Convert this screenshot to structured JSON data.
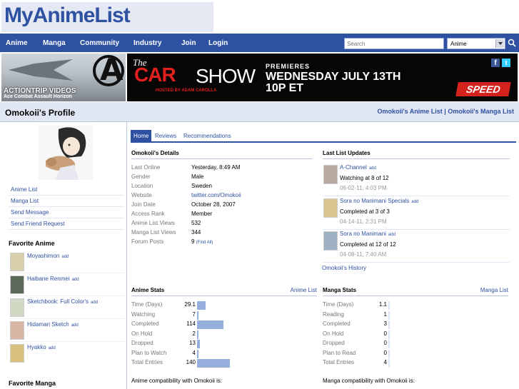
{
  "logo": {
    "text": "MyAnimeList"
  },
  "nav": {
    "items": [
      "Anime",
      "Manga",
      "Community",
      "Industry",
      "Join",
      "Login"
    ]
  },
  "search": {
    "placeholder": "Search",
    "type_selected": "Anime"
  },
  "ads": {
    "left_title": "ACTIONTRIP VIDEOS",
    "left_sub": "Ace Combat Assault Horizon",
    "right_the": "The",
    "right_car": "CAR",
    "right_show": "SHOW",
    "right_host": "HOSTED BY ADAM CAROLLA",
    "right_premieres": "PREMIERES",
    "right_date": "WEDNESDAY JULY 13TH",
    "right_time": "10P ET",
    "right_brand": "SPEED"
  },
  "header": {
    "title": "Omokoii's Profile",
    "anime_list_link": "Omokoii's Anime List",
    "separator": "|",
    "manga_list_link": "Omokoii's Manga List"
  },
  "sidebar": {
    "links": [
      "Anime List",
      "Manga List",
      "Send Message",
      "Send Friend Request"
    ],
    "favorite_anime_heading": "Favorite Anime",
    "favorite_anime": [
      {
        "name": "Moyashimon",
        "add": "add"
      },
      {
        "name": "Haibane Renmei",
        "add": "add"
      },
      {
        "name": "Sketchbook: Full Color's",
        "add": "add"
      },
      {
        "name": "Hidamari Sketch",
        "add": "add"
      },
      {
        "name": "Hyakko",
        "add": "add"
      }
    ],
    "favorite_manga_heading": "Favorite Manga"
  },
  "tabs": [
    "Home",
    "Reviews",
    "Recommendations"
  ],
  "details": {
    "heading": "Omokoii's Details",
    "rows": [
      {
        "k": "Last Online",
        "v": "Yesterday, 8:49 AM"
      },
      {
        "k": "Gender",
        "v": "Male"
      },
      {
        "k": "Location",
        "v": "Sweden"
      },
      {
        "k": "Website",
        "v": "twitter.com/Omokoii"
      },
      {
        "k": "Join Date",
        "v": "October 28, 2007"
      },
      {
        "k": "Access Rank",
        "v": "Member"
      },
      {
        "k": "Anime List Views",
        "v": "532"
      },
      {
        "k": "Manga List Views",
        "v": "344"
      },
      {
        "k": "Forum Posts",
        "v": "9",
        "extra": "(Find All)"
      }
    ]
  },
  "updates": {
    "heading": "Last List Updates",
    "items": [
      {
        "name": "A-Channel",
        "add": "add",
        "status": "Watching at 8 of 12",
        "date": "06-02-11, 4:03 PM"
      },
      {
        "name": "Sora no Manimani Specials",
        "add": "add",
        "status": "Completed at 3 of 3",
        "date": "04-14-11, 2:31 PM"
      },
      {
        "name": "Sora no Manimani",
        "add": "add",
        "status": "Completed at 12 of 12",
        "date": "04-08-11, 7:40 AM"
      }
    ],
    "history_link": "Omokoii's History"
  },
  "anime_stats": {
    "heading": "Anime Stats",
    "link": "Anime List",
    "rows": [
      {
        "k": "Time (Days)",
        "v": "29.1",
        "fraction": 0.25
      },
      {
        "k": "Watching",
        "v": "7",
        "fraction": 0.05
      },
      {
        "k": "Completed",
        "v": "114",
        "fraction": 0.81
      },
      {
        "k": "On Hold",
        "v": "2",
        "fraction": 0.015
      },
      {
        "k": "Dropped",
        "v": "13",
        "fraction": 0.09
      },
      {
        "k": "Plan to Watch",
        "v": "4",
        "fraction": 0.03
      },
      {
        "k": "Total Entries",
        "v": "140",
        "fraction": 1.0
      }
    ],
    "compat": "Anime compatibility with Omokoii is:"
  },
  "manga_stats": {
    "heading": "Manga Stats",
    "link": "Manga List",
    "rows": [
      {
        "k": "Time (Days)",
        "v": "1.1"
      },
      {
        "k": "Reading",
        "v": "1"
      },
      {
        "k": "Completed",
        "v": "3"
      },
      {
        "k": "On Hold",
        "v": "0"
      },
      {
        "k": "Dropped",
        "v": "0"
      },
      {
        "k": "Plan to Read",
        "v": "0"
      },
      {
        "k": "Total Entries",
        "v": "4"
      }
    ],
    "compat": "Manga compatibility with Omokoii is:"
  },
  "colors": {
    "brand": "#2e51a2",
    "bar": "#95aedb",
    "title_bg": "#e1e7f5"
  }
}
